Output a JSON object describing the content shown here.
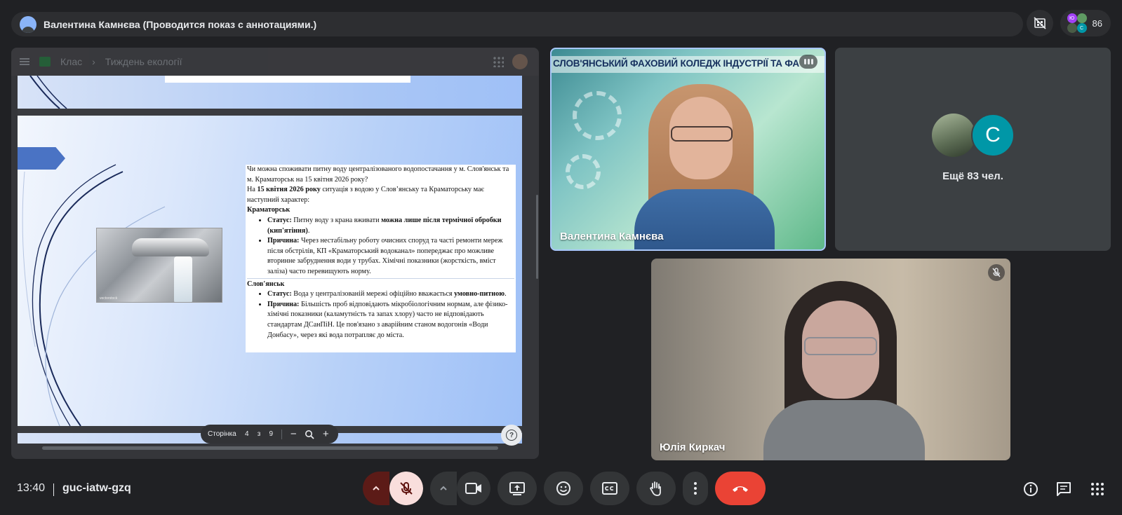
{
  "header": {
    "presenter_title": "Валентина Камнєва (Проводится показ с аннотациями.)",
    "participant_count": "86",
    "mini_avatar_letters": [
      "Ю",
      "С"
    ]
  },
  "shared_doc": {
    "breadcrumb_root": "Клас",
    "breadcrumb_page": "Тиждень екології",
    "image_caption": "vectorstock",
    "text": {
      "question": "Чи можна споживати питну воду централізованого водопостачання у м. Слов'янськ та м. Краматорськ на 15 квітня 2026 року?",
      "intro_prefix": "На ",
      "intro_date": "15 квітня 2026 року",
      "intro_suffix": " ситуація з водою у Слов’янську та Краматорську має наступний характер:",
      "city1": "Краматорськ",
      "city1_status_label": "Статус:",
      "city1_status_text": " Питну воду з крана вживати ",
      "city1_status_bold": "можна лише після термічної обробки (кип'ятіння)",
      "city1_status_end": ".",
      "city1_reason_label": "Причина:",
      "city1_reason_text": " Через нестабільну роботу очисних споруд та часті ремонти мереж після обстрілів, КП «Краматорський водоканал» попереджає про можливе вторинне забруднення води у трубах. Хімічні показники (жорсткість, вміст заліза) часто перевищують норму.",
      "city2": "Слов'янськ",
      "city2_status_label": "Статус:",
      "city2_status_text": " Вода у централізованій мережі офіційно вважається ",
      "city2_status_bold": "умовно-питною",
      "city2_status_end": ".",
      "city2_reason_label": "Причина:",
      "city2_reason_text": " Більшість проб відповідають мікробіологічним нормам, але фізико-хімічні показники (каламутність та запах хлору) часто не відповідають стандартам ДСанПіН. Це пов'язано з аварійним станом водогонів «Води Донбасу», через які вода потрапляє до міста."
    },
    "pager": {
      "label": "Сторінка",
      "current": "4",
      "of": "з",
      "total": "9",
      "zoom_out": "−",
      "zoom_in": "+"
    },
    "help": "?"
  },
  "tiles": {
    "valentina": {
      "banner": "СЛОВ'ЯНСЬКИЙ ФАХОВИЙ КОЛЕДЖ ІНДУСТРІЇ ТА ФА",
      "name": "Валентина Камнєва"
    },
    "others": {
      "letter": "С",
      "label": "Ещё 83 чел."
    },
    "yulia": {
      "name": "Юлія Киркач"
    }
  },
  "footer": {
    "time": "13:40",
    "meeting_code": "guc-iatw-gzq"
  },
  "colors": {
    "hangup": "#ea4335",
    "mic_off_bg": "#f9dedc",
    "accent_border": "#a8c7fa",
    "avatar_teal": "#0097a7"
  }
}
